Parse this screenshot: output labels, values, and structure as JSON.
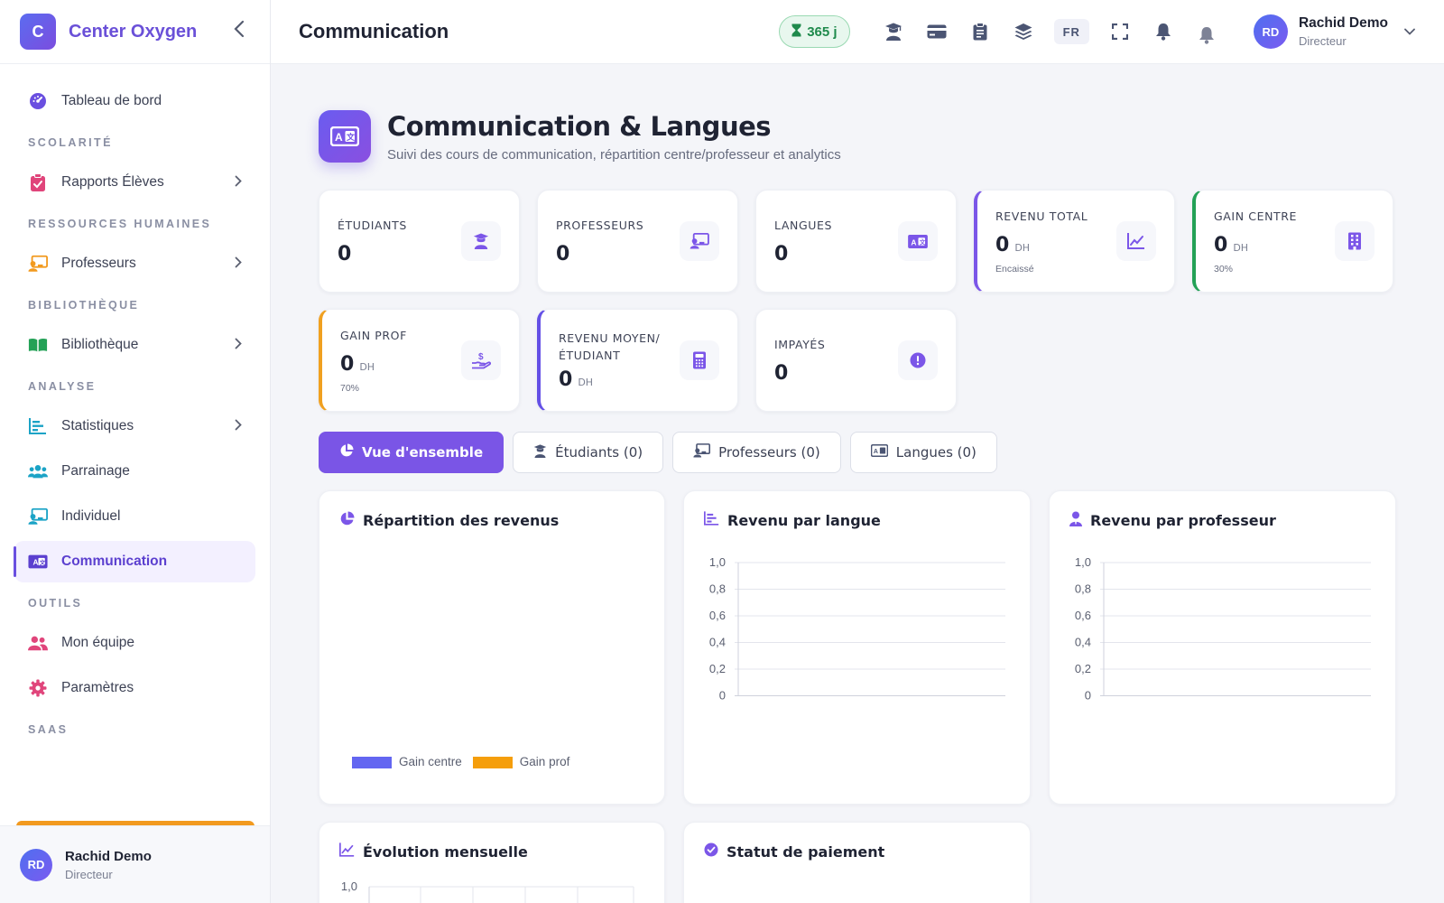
{
  "brand": {
    "logo_letter": "C",
    "name": "Center Oxygen"
  },
  "sidebar": {
    "items": [
      {
        "label": "Tableau de bord",
        "icon": "gauge-icon",
        "color": "#6a4fe0"
      },
      {
        "section": "SCOLARITÉ"
      },
      {
        "label": "Rapports Élèves",
        "icon": "clipboard-icon",
        "color": "#e0457b",
        "chevron": true
      },
      {
        "section": "RESSOURCES HUMAINES"
      },
      {
        "label": "Professeurs",
        "icon": "teacher-icon",
        "color": "#f29a1f",
        "chevron": true
      },
      {
        "section": "BIBLIOTHÈQUE"
      },
      {
        "label": "Bibliothèque",
        "icon": "book-open-icon",
        "color": "#23a156",
        "chevron": true
      },
      {
        "section": "ANALYSE"
      },
      {
        "label": "Statistiques",
        "icon": "bar-chart-icon",
        "color": "#1ba3c6",
        "chevron": true
      },
      {
        "label": "Parrainage",
        "icon": "users-icon",
        "color": "#1ba3c6"
      },
      {
        "label": "Individuel",
        "icon": "teacher-icon",
        "color": "#1ba3c6"
      },
      {
        "label": "Communication",
        "icon": "language-icon",
        "color": "#5b3fcf",
        "active": true
      },
      {
        "section": "OUTILS"
      },
      {
        "label": "Mon équipe",
        "icon": "team-icon",
        "color": "#e0457b"
      },
      {
        "label": "Paramètres",
        "icon": "gear-icon",
        "color": "#e0457b"
      },
      {
        "section": "SAAS"
      }
    ],
    "user": {
      "initials": "RD",
      "name": "Rachid Demo",
      "role": "Directeur"
    }
  },
  "topbar": {
    "title": "Communication",
    "days_badge": "365 j",
    "lang": "FR",
    "user": {
      "initials": "RD",
      "name": "Rachid Demo",
      "role": "Directeur"
    }
  },
  "header": {
    "title": "Communication & Langues",
    "subtitle": "Suivi des cours de communication, répartition centre/professeur et analytics"
  },
  "stats": [
    {
      "label": "ÉTUDIANTS",
      "value": "0",
      "icon": "graduate-icon"
    },
    {
      "label": "PROFESSEURS",
      "value": "0",
      "icon": "teacher-icon"
    },
    {
      "label": "LANGUES",
      "value": "0",
      "icon": "language-icon"
    },
    {
      "label": "REVENU TOTAL",
      "value": "0",
      "unit": "DH",
      "note": "Encaissé",
      "icon": "line-chart-icon"
    },
    {
      "label": "GAIN CENTRE",
      "value": "0",
      "unit": "DH",
      "note": "30%",
      "icon": "building-icon"
    },
    {
      "label": "GAIN PROF",
      "value": "0",
      "unit": "DH",
      "note": "70%",
      "icon": "hand-money-icon"
    },
    {
      "label": "REVENU MOYEN/ ÉTUDIANT",
      "value": "0",
      "unit": "DH",
      "icon": "calculator-icon"
    },
    {
      "label": "IMPAYÉS",
      "value": "0",
      "icon": "alert-circle-icon"
    }
  ],
  "tabs": [
    {
      "label": "Vue d'ensemble",
      "active": true
    },
    {
      "label": "Étudiants (0)"
    },
    {
      "label": "Professeurs (0)"
    },
    {
      "label": "Langues (0)"
    }
  ],
  "panels": {
    "repartition": {
      "title": "Répartition des revenus",
      "legend": [
        "Gain centre",
        "Gain prof"
      ]
    },
    "par_langue": {
      "title": "Revenu par langue"
    },
    "par_prof": {
      "title": "Revenu par professeur"
    },
    "evolution": {
      "title": "Évolution mensuelle"
    },
    "statut": {
      "title": "Statut de paiement"
    }
  },
  "chart_data": [
    {
      "type": "pie",
      "title": "Répartition des revenus",
      "categories": [
        "Gain centre",
        "Gain prof"
      ],
      "values": [
        0,
        0
      ],
      "colors": [
        "#6366f1",
        "#f59e0b"
      ]
    },
    {
      "type": "bar",
      "title": "Revenu par langue",
      "categories": [],
      "values": [],
      "ylim": [
        0,
        1
      ],
      "yticks": [
        "1,0",
        "0,8",
        "0,6",
        "0,4",
        "0,2",
        "0"
      ]
    },
    {
      "type": "bar",
      "title": "Revenu par professeur",
      "categories": [],
      "values": [],
      "ylim": [
        0,
        1
      ],
      "yticks": [
        "1,0",
        "0,8",
        "0,6",
        "0,4",
        "0,2",
        "0"
      ]
    },
    {
      "type": "line",
      "title": "Évolution mensuelle",
      "x": [],
      "values": [],
      "yticks": [
        "1,0"
      ]
    }
  ]
}
